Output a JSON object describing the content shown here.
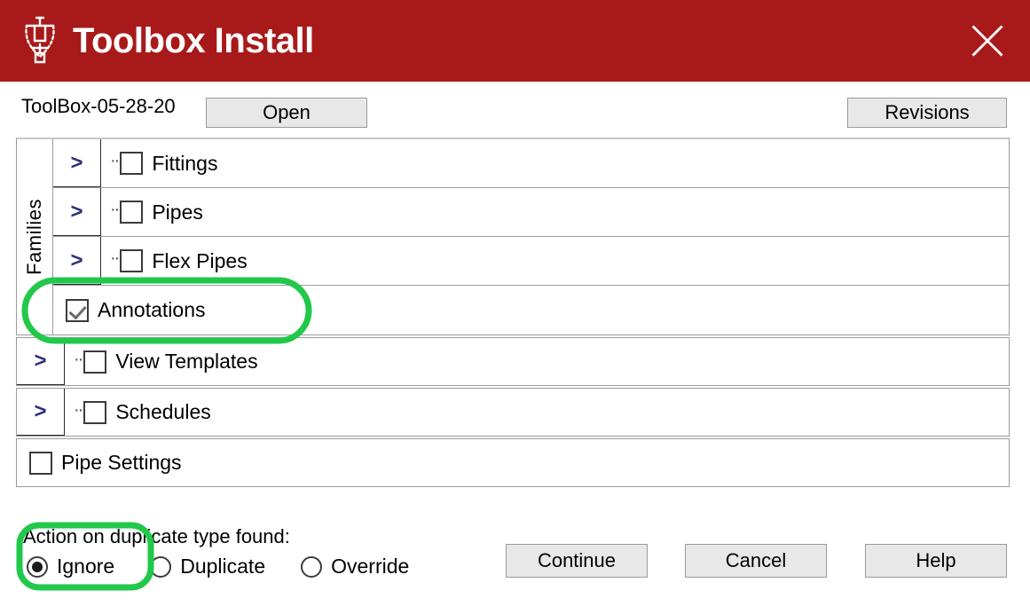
{
  "window": {
    "title": "Toolbox Install",
    "icon": "plumb-bob-icon",
    "close_icon": "close-icon",
    "titlebar_color": "#a81a1a"
  },
  "toolbar": {
    "file_name": "ToolBox-05-28-20",
    "open_label": "Open",
    "revisions_label": "Revisions"
  },
  "tree": {
    "group_label": "Families",
    "expander_glyph": ">",
    "tree_connector": "··",
    "group_rows": [
      {
        "label": "Fittings",
        "checked": false,
        "expandable": true,
        "connector": true
      },
      {
        "label": "Pipes",
        "checked": false,
        "expandable": true,
        "connector": true
      },
      {
        "label": "Flex Pipes",
        "checked": false,
        "expandable": true,
        "connector": true
      },
      {
        "label": "Annotations",
        "checked": true,
        "expandable": false,
        "connector": false
      }
    ],
    "standalone_rows": [
      {
        "label": "View Templates",
        "checked": false,
        "expandable": true,
        "connector": true
      },
      {
        "label": "Schedules",
        "checked": false,
        "expandable": true,
        "connector": true
      },
      {
        "label": "Pipe Settings",
        "checked": false,
        "expandable": false,
        "connector": false
      }
    ]
  },
  "duplicate_action": {
    "label": "Action on duplicate type found:",
    "options": [
      {
        "label": "Ignore",
        "selected": true
      },
      {
        "label": "Duplicate",
        "selected": false
      },
      {
        "label": "Override",
        "selected": false
      }
    ]
  },
  "buttons": {
    "continue_label": "Continue",
    "cancel_label": "Cancel",
    "help_label": "Help"
  },
  "annotations": {
    "color": "#22c84a",
    "highlight_annotations_row": "Annotations",
    "highlight_ignore_option": "Ignore"
  }
}
